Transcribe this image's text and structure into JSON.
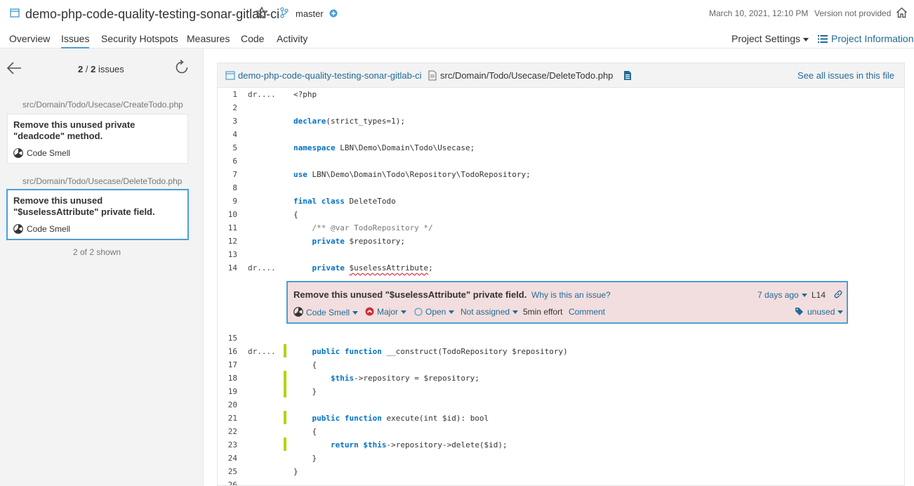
{
  "header": {
    "project_title": "demo-php-code-quality-testing-sonar-gitlab-ci",
    "branch": "master",
    "date": "March 10, 2021, 12:10 PM",
    "version": "Version not provided"
  },
  "nav": {
    "tabs": [
      "Overview",
      "Issues",
      "Security Hotspots",
      "Measures",
      "Code",
      "Activity"
    ],
    "active_tab": "Issues",
    "project_settings": "Project Settings",
    "project_information": "Project Information"
  },
  "sidebar": {
    "count_current": "2",
    "count_total": "2",
    "count_label": "issues",
    "issues": [
      {
        "file": "src/Domain/Todo/Usecase/CreateTodo.php",
        "message": "Remove this unused private \"deadcode\" method.",
        "type": "Code Smell"
      },
      {
        "file": "src/Domain/Todo/Usecase/DeleteTodo.php",
        "message": "Remove this unused \"$uselessAttribute\" private field.",
        "type": "Code Smell"
      }
    ],
    "shown": "2 of 2 shown"
  },
  "viewer": {
    "project": "demo-php-code-quality-testing-sonar-gitlab-ci",
    "file": "src/Domain/Todo/Usecase/DeleteTodo.php",
    "see_all": "See all issues in this file",
    "scm_author": "dr....",
    "lines": [
      {
        "n": "1",
        "code": "<?php"
      },
      {
        "n": "2",
        "code": ""
      },
      {
        "n": "3",
        "code": "declare(strict_types=1);"
      },
      {
        "n": "4",
        "code": ""
      },
      {
        "n": "5",
        "code": "namespace LBN\\Demo\\Domain\\Todo\\Usecase;"
      },
      {
        "n": "6",
        "code": ""
      },
      {
        "n": "7",
        "code": "use LBN\\Demo\\Domain\\Todo\\Repository\\TodoRepository;"
      },
      {
        "n": "8",
        "code": ""
      },
      {
        "n": "9",
        "code": "final class DeleteTodo"
      },
      {
        "n": "10",
        "code": "{"
      },
      {
        "n": "11",
        "code": "    /** @var TodoRepository */"
      },
      {
        "n": "12",
        "code": "    private $repository;"
      },
      {
        "n": "13",
        "code": ""
      },
      {
        "n": "14",
        "code": "    private $uselessAttribute;"
      },
      {
        "n": "15",
        "code": ""
      },
      {
        "n": "16",
        "code": "    public function __construct(TodoRepository $repository)"
      },
      {
        "n": "17",
        "code": "    {"
      },
      {
        "n": "18",
        "code": "        $this->repository = $repository;"
      },
      {
        "n": "19",
        "code": "    }"
      },
      {
        "n": "20",
        "code": ""
      },
      {
        "n": "21",
        "code": "    public function execute(int $id): bool"
      },
      {
        "n": "22",
        "code": "    {"
      },
      {
        "n": "23",
        "code": "        return $this->repository->delete($id);"
      },
      {
        "n": "24",
        "code": "    }"
      },
      {
        "n": "25",
        "code": "}"
      },
      {
        "n": "26",
        "code": ""
      }
    ],
    "issue": {
      "message": "Remove this unused \"$uselessAttribute\" private field.",
      "why": "Why is this an issue?",
      "age": "7 days ago",
      "line": "L14",
      "type": "Code Smell",
      "severity": "Major",
      "status": "Open",
      "assignee": "Not assigned",
      "effort": "5min effort",
      "comment": "Comment",
      "tag": "unused"
    }
  },
  "colors": {
    "accent": "#4b9fd5",
    "link": "#236a97",
    "issue_bg": "#f2dede",
    "coverage": "#b0d513",
    "major": "#d02f3a"
  }
}
